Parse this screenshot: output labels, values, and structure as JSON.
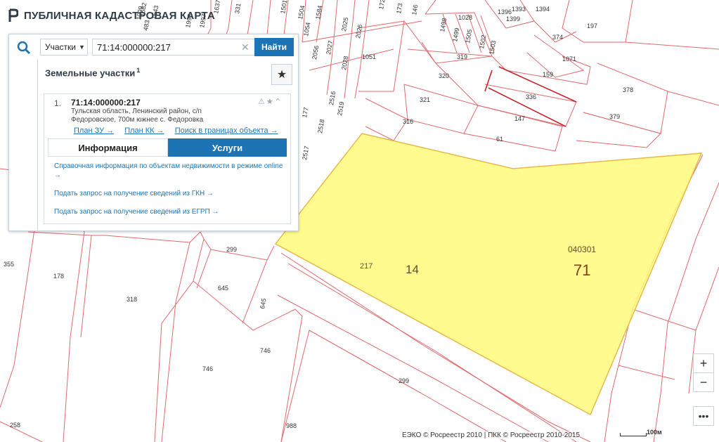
{
  "app": {
    "title": "ПУБЛИЧНАЯ КАДАСТРОВАЯ КАРТА"
  },
  "search": {
    "object_type": "Участки",
    "query": "71:14:000000:217",
    "clear_icon": "close-icon",
    "button": "Найти"
  },
  "results": {
    "title": "Земельные участки",
    "count": "1",
    "items": [
      {
        "index": "1.",
        "cad_number": "71:14:000000:217",
        "address": "Тульская область, Ленинский район, с/п Федоровское, 700м южнее с. Федоровка",
        "links": [
          "План ЗУ →",
          "План КК →",
          "Поиск в границах объекта →"
        ],
        "tabs": [
          "Информация",
          "Услуги"
        ],
        "active_tab": "Услуги",
        "services": [
          "Справочная информация по объектам недвижимости в режиме online →",
          "Подать запрос на получение сведений из ГКН →",
          "Подать запрос на получение сведений из ЕГРП →"
        ]
      }
    ]
  },
  "map": {
    "selected_parcel_label": "217",
    "district_code": "14",
    "region_code": "71",
    "quarter_code": "040301",
    "parcel_labels": [
      "1637",
      "331",
      "1501",
      "1504",
      "1054",
      "1584",
      "1582",
      "1543",
      "1997",
      "1993",
      "483",
      "172",
      "173",
      "146",
      "1498",
      "1028",
      "1393",
      "1394",
      "1396",
      "1399",
      "197",
      "1499",
      "1505",
      "1503",
      "1502",
      "374",
      "1071",
      "319",
      "320",
      "1051",
      "2025",
      "2026",
      "2027",
      "2028",
      "2056",
      "159",
      "336",
      "378",
      "321",
      "147",
      "379",
      "316",
      "61",
      "2519",
      "2516",
      "2518",
      "2517",
      "177",
      "299",
      "355",
      "178",
      "318",
      "645",
      "746",
      "258",
      "988",
      "1009"
    ],
    "colors": {
      "parcel_line": "#e06a6e",
      "selected_fill": "#fffa7a",
      "selected_line": "#e8b84a",
      "accent": "#1d74b5"
    }
  },
  "controls": {
    "zoom_in": "+",
    "zoom_out": "−",
    "more": "•••"
  },
  "footer": {
    "copyright": "ЕЭКО © Росреестр 2010 | ПКК © Росреестр 2010-2015",
    "scale": "100м"
  }
}
